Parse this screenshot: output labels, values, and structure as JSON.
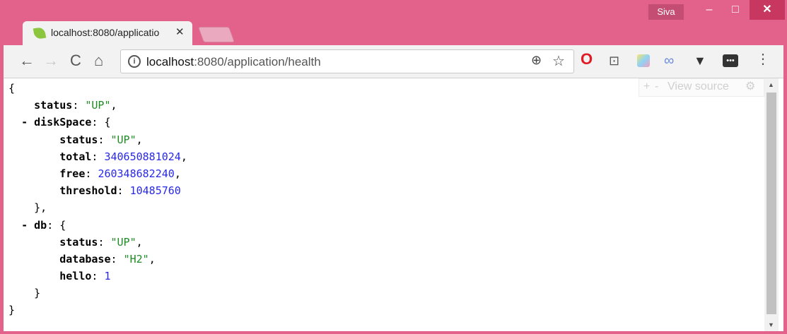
{
  "titlebar": {
    "profile_name": "Siva",
    "minimize": "–",
    "maximize": "□",
    "close": "✕"
  },
  "tab": {
    "title": "localhost:8080/applicatio",
    "close": "✕"
  },
  "nav": {
    "back": "←",
    "forward": "→",
    "reload": "C",
    "home": "⌂"
  },
  "address": {
    "host": "localhost",
    "rest": ":8080/application/health"
  },
  "json_view": {
    "open_root": "{",
    "status_key": "status",
    "status_val": "\"UP\"",
    "diskspace_toggle": "-",
    "diskspace_key": "diskSpace",
    "ds_status_key": "status",
    "ds_status_val": "\"UP\"",
    "ds_total_key": "total",
    "ds_total_val": "340650881024",
    "ds_free_key": "free",
    "ds_free_val": "260348682240",
    "ds_threshold_key": "threshold",
    "ds_threshold_val": "10485760",
    "close_diskspace": "},",
    "db_toggle": "-",
    "db_key": "db",
    "db_status_key": "status",
    "db_status_val": "\"UP\"",
    "db_database_key": "database",
    "db_database_val": "\"H2\"",
    "db_hello_key": "hello",
    "db_hello_val": "1",
    "close_db": "}",
    "close_root": "}"
  },
  "viewer": {
    "plus": "+",
    "minus": "-",
    "view_source": "View source"
  },
  "colors": {
    "frame": "#e2628c",
    "string": "#1f8b24",
    "number": "#2828e8"
  }
}
